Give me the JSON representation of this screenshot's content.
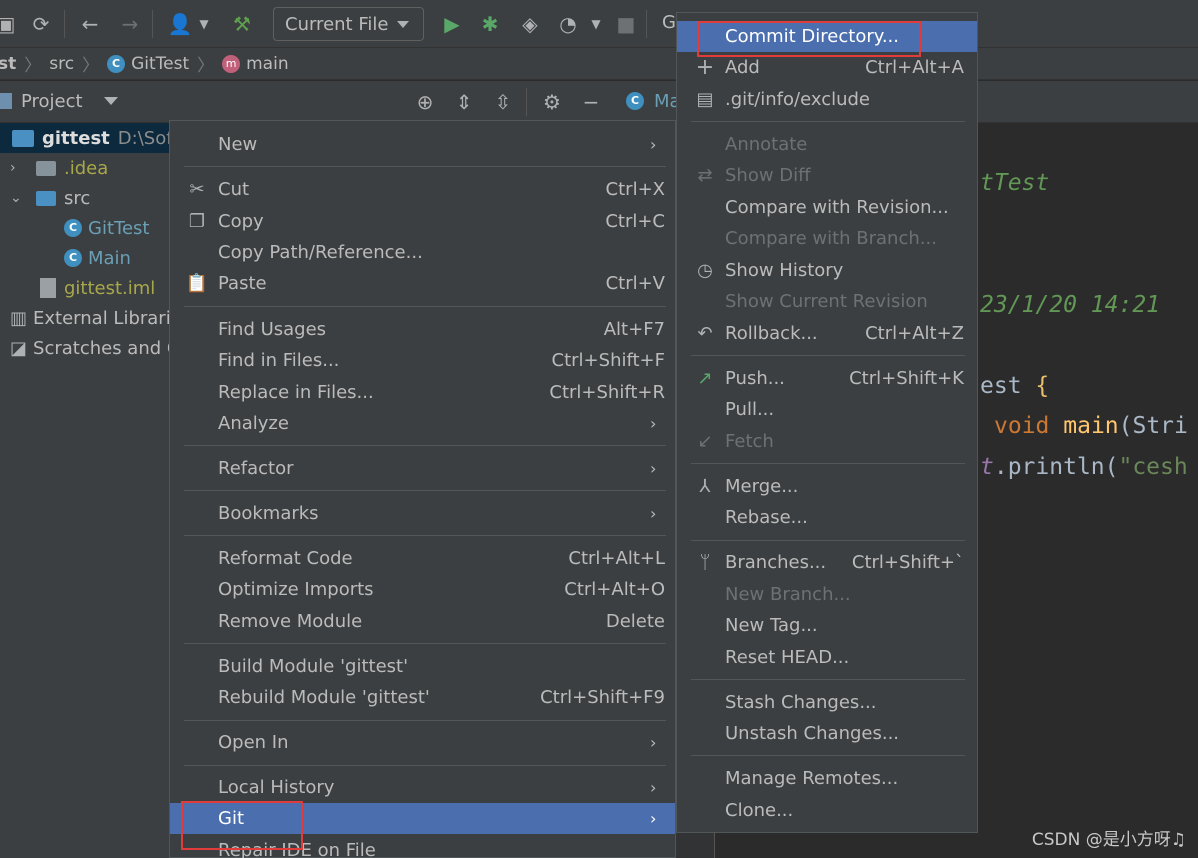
{
  "toolbar": {
    "run_config": "Current File",
    "partial_label": "G"
  },
  "breadcrumb": {
    "project_partial": "st",
    "src": "src",
    "class": "GitTest",
    "method": "main"
  },
  "project_panel": {
    "title": "Project",
    "root_name": "gittest",
    "root_path": "D:\\SoftP",
    "items": {
      "idea": ".idea",
      "src": "src",
      "gittest_class": "GitTest",
      "main_class": "Main",
      "iml": "gittest.iml",
      "external": "External Librari",
      "scratches": "Scratches and C"
    }
  },
  "editor": {
    "tab_partial": "Ma",
    "line1": "tTest",
    "line2": "23/1/20 14:21",
    "line3_a": "est ",
    "line3_b": "{",
    "line4_a": "void ",
    "line4_b": "main",
    "line4_c": "(Stri",
    "line5_a": "t",
    "line5_b": ".println(",
    "line5_c": "\"cesh"
  },
  "context_menu": {
    "new": "New",
    "cut": "Cut",
    "cut_sc": "Ctrl+X",
    "copy": "Copy",
    "copy_sc": "Ctrl+C",
    "copy_path": "Copy Path/Reference...",
    "paste": "Paste",
    "paste_sc": "Ctrl+V",
    "find_usages": "Find Usages",
    "find_usages_sc": "Alt+F7",
    "find_in_files": "Find in Files...",
    "find_in_files_sc": "Ctrl+Shift+F",
    "replace_in_files": "Replace in Files...",
    "replace_in_files_sc": "Ctrl+Shift+R",
    "analyze": "Analyze",
    "refactor": "Refactor",
    "bookmarks": "Bookmarks",
    "reformat": "Reformat Code",
    "reformat_sc": "Ctrl+Alt+L",
    "optimize": "Optimize Imports",
    "optimize_sc": "Ctrl+Alt+O",
    "remove_module": "Remove Module",
    "remove_module_sc": "Delete",
    "build_module": "Build Module 'gittest'",
    "rebuild_module": "Rebuild Module 'gittest'",
    "rebuild_module_sc": "Ctrl+Shift+F9",
    "open_in": "Open In",
    "local_history": "Local History",
    "git": "Git",
    "repair_ide": "Repair IDE on File"
  },
  "git_menu": {
    "commit_dir": "Commit Directory...",
    "add": "Add",
    "add_sc": "Ctrl+Alt+A",
    "exclude": ".git/info/exclude",
    "annotate": "Annotate",
    "show_diff": "Show Diff",
    "compare_revision": "Compare with Revision...",
    "compare_branch": "Compare with Branch...",
    "show_history": "Show History",
    "show_current_revision": "Show Current Revision",
    "rollback": "Rollback...",
    "rollback_sc": "Ctrl+Alt+Z",
    "push": "Push...",
    "push_sc": "Ctrl+Shift+K",
    "pull": "Pull...",
    "fetch": "Fetch",
    "merge": "Merge...",
    "rebase": "Rebase...",
    "branches": "Branches...",
    "branches_sc": "Ctrl+Shift+`",
    "new_branch": "New Branch...",
    "new_tag": "New Tag...",
    "reset_head": "Reset HEAD...",
    "stash": "Stash Changes...",
    "unstash": "Unstash Changes...",
    "manage_remotes": "Manage Remotes...",
    "clone": "Clone..."
  },
  "watermark": "CSDN @是小方呀♫",
  "colors": {
    "highlight": "#4b6eaf",
    "annotation_box": "#e03c3c",
    "menu_bg": "#3c3f41"
  }
}
